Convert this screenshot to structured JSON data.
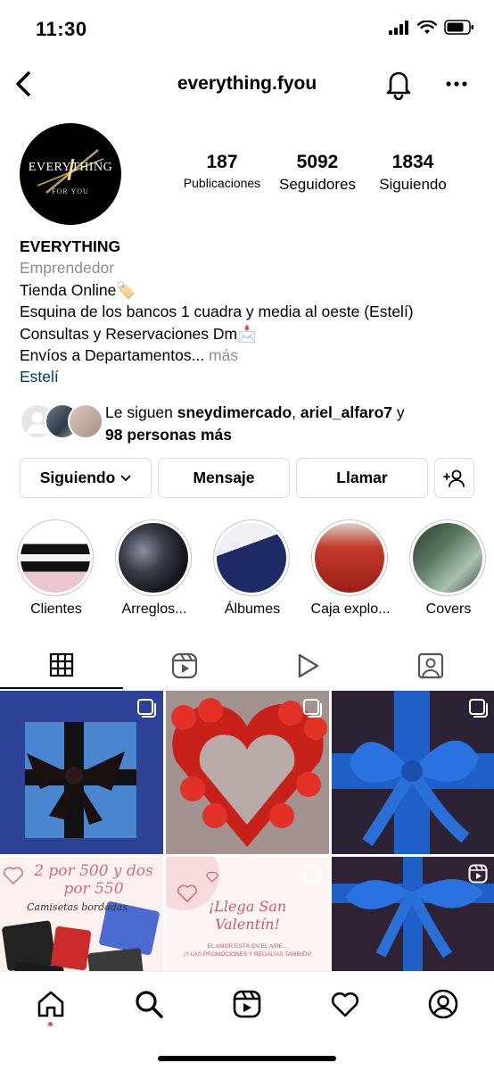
{
  "status_bar": {
    "time": "11:30"
  },
  "header": {
    "username": "everything.fyou"
  },
  "profile": {
    "avatar_text_main": "EVERYTHING",
    "avatar_text_sub": "FOR YOU",
    "stats": [
      {
        "value": "187",
        "label": "Publicaciones"
      },
      {
        "value": "5092",
        "label": "Seguidores"
      },
      {
        "value": "1834",
        "label": "Siguiendo"
      }
    ]
  },
  "bio": {
    "name": "EVERYTHING",
    "category": "Emprendedor",
    "line1": "Tienda Online🏷️",
    "line2": "Esquina de los bancos 1 cuadra y media al oeste (Estelí)",
    "line3": "Consultas y Reservaciones Dm📩",
    "line4": "Envíos a Departamentos...",
    "more": " más",
    "location": "Estelí"
  },
  "followed_by": {
    "prefix": "Le siguen ",
    "user1": "sneydimercado",
    "sep": ", ",
    "user2": "ariel_alfaro7",
    "and": " y",
    "others": "98 personas más"
  },
  "actions": {
    "following": "Siguiendo",
    "message": "Mensaje",
    "call": "Llamar"
  },
  "highlights": [
    {
      "label": "Clientes"
    },
    {
      "label": "Arreglos..."
    },
    {
      "label": "Álbumes"
    },
    {
      "label": "Caja explo..."
    },
    {
      "label": "Covers"
    }
  ],
  "posts": {
    "post4_title_1": "2 por 500 y dos",
    "post4_title_2": "por 550",
    "post4_sub": "Camisetas bordadas",
    "post5_title_1": "¡Llega San",
    "post5_title_2": "Valentín!",
    "post5_sub_1": "EL AMOR ESTÁ EN EL AIRE...",
    "post5_sub_2": "¡Y LAS PROMOCIONES Y REGALÍAS TAMBIÉN!"
  },
  "colors": {
    "link": "#00376b",
    "muted": "#8e8e8e",
    "border": "#dbdbdb",
    "notification_dot": "#ed4956"
  }
}
